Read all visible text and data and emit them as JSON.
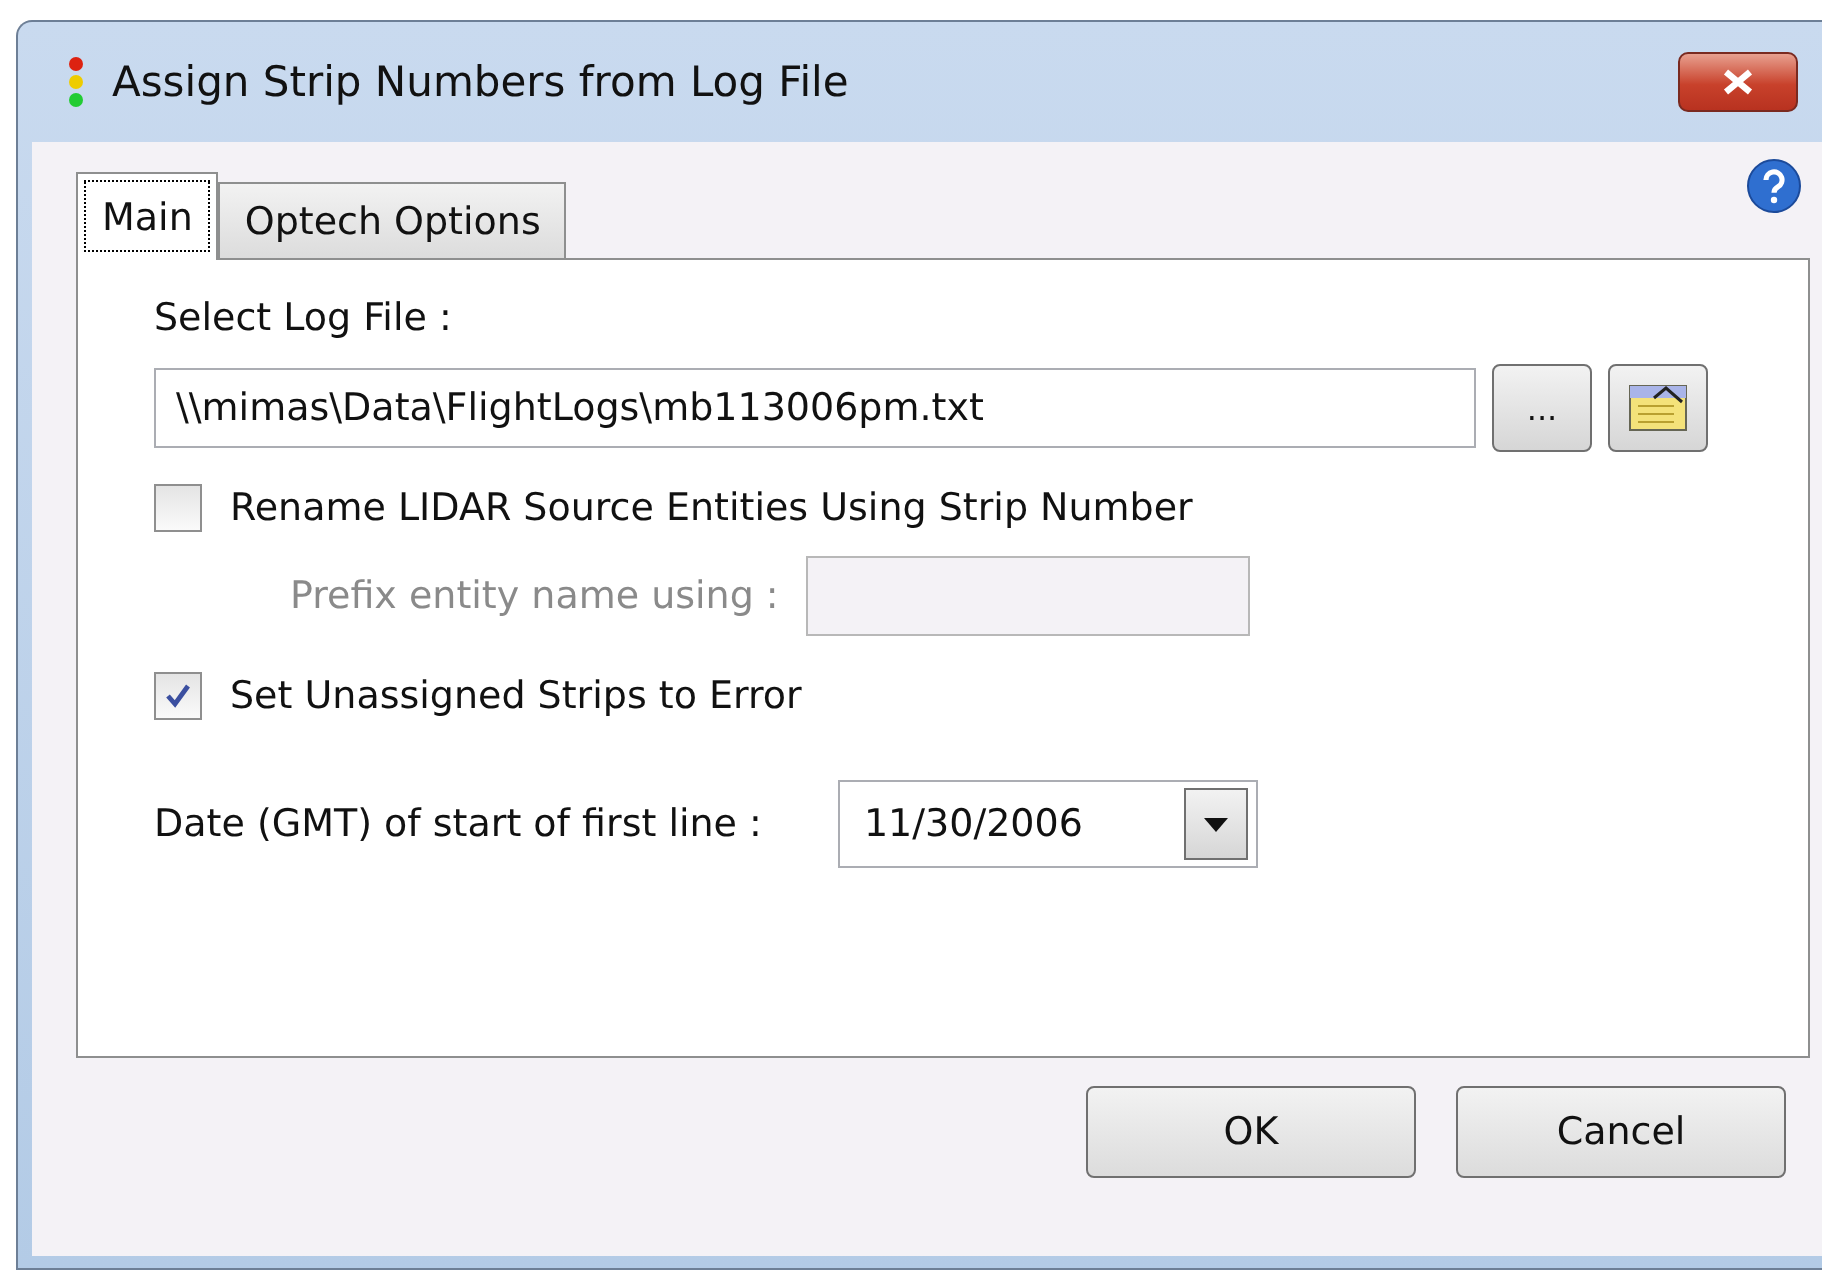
{
  "window": {
    "title": "Assign Strip Numbers from Log File"
  },
  "tabs": [
    {
      "label": "Main",
      "selected": true
    },
    {
      "label": "Optech Options",
      "selected": false
    }
  ],
  "log_file": {
    "label": "Select Log File :",
    "value": "\\\\mimas\\Data\\FlightLogs\\mb113006pm.txt",
    "browse": "..."
  },
  "rename": {
    "label": "Rename LIDAR Source Entities Using Strip Number",
    "checked": false
  },
  "prefix": {
    "label": "Prefix entity name using :",
    "disabled": true
  },
  "unassigned": {
    "label": "Set Unassigned Strips to Error",
    "checked": true
  },
  "date": {
    "label": "Date (GMT) of start of first line :",
    "value": "11/30/2006"
  },
  "buttons": [
    "OK",
    "Cancel"
  ]
}
